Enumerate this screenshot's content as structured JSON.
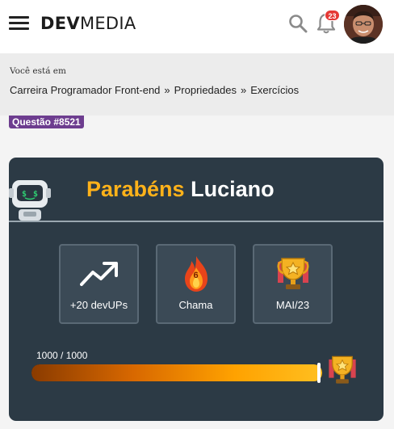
{
  "header": {
    "logo_bold": "DEV",
    "logo_light": "MEDIA",
    "notifications_count": "23"
  },
  "breadcrumb": {
    "label": "Você está em",
    "items": [
      "Carreira Programador Front-end",
      "Propriedades",
      "Exercícios"
    ],
    "separator": "»"
  },
  "question_tag": "Questão #8521",
  "card": {
    "title_highlight": "Parabéns",
    "title_name": "Luciano",
    "stats": [
      {
        "icon": "trending-up-icon",
        "label": "+20 devUPs"
      },
      {
        "icon": "flame-icon",
        "value": "6",
        "label": "Chama"
      },
      {
        "icon": "trophy-icon",
        "label": "MAI/23"
      }
    ],
    "xp_text": "1000 / 1000",
    "xp_progress": 1.0
  },
  "colors": {
    "card_bg": "#2c3a45",
    "accent_yellow": "#ffb21a",
    "tag_purple": "#6d3d8f",
    "badge_red": "#e53935"
  }
}
